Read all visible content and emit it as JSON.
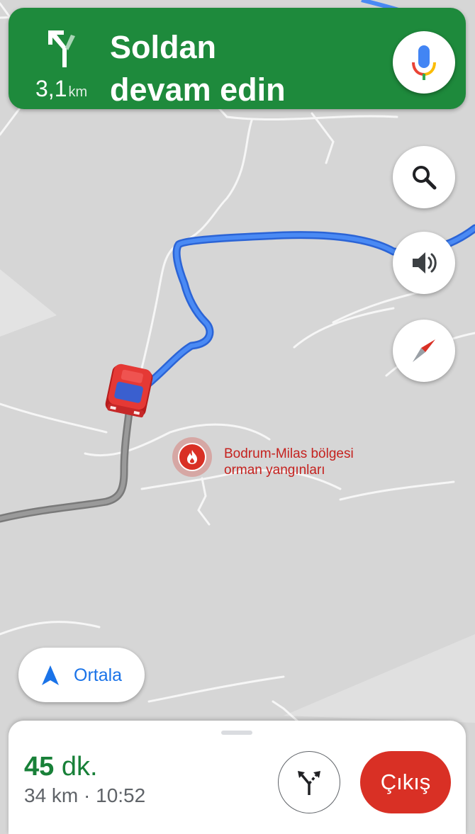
{
  "colors": {
    "nav_green": "#1e8a3c",
    "route_blue": "#4285f4",
    "traveled_gray": "#8a8a8a",
    "incident_red": "#d93025",
    "eta_green": "#188038",
    "link_blue": "#1a73e8",
    "map_bg": "#d6d6d6"
  },
  "navigation": {
    "maneuver_icon": "turn-slight-left-icon",
    "distance_value": "3,1",
    "distance_unit": "km",
    "instruction_line1": "Soldan",
    "instruction_line2": "devam edin",
    "mic_icon": "microphone-icon"
  },
  "map_controls": {
    "search_icon": "search-icon",
    "sound_icon": "volume-icon",
    "compass_icon": "compass-icon"
  },
  "incident": {
    "icon": "fire-icon",
    "label_line1": "Bodrum-Milas bölgesi",
    "label_line2": "orman yangınları"
  },
  "recenter": {
    "icon": "navigation-arrow-icon",
    "label": "Ortala"
  },
  "trip": {
    "duration_value": "45",
    "duration_unit": "dk.",
    "distance_and_arrival": "34 km · 10:52",
    "alternate_routes_icon": "alternate-routes-icon",
    "exit_label": "Çıkış"
  }
}
